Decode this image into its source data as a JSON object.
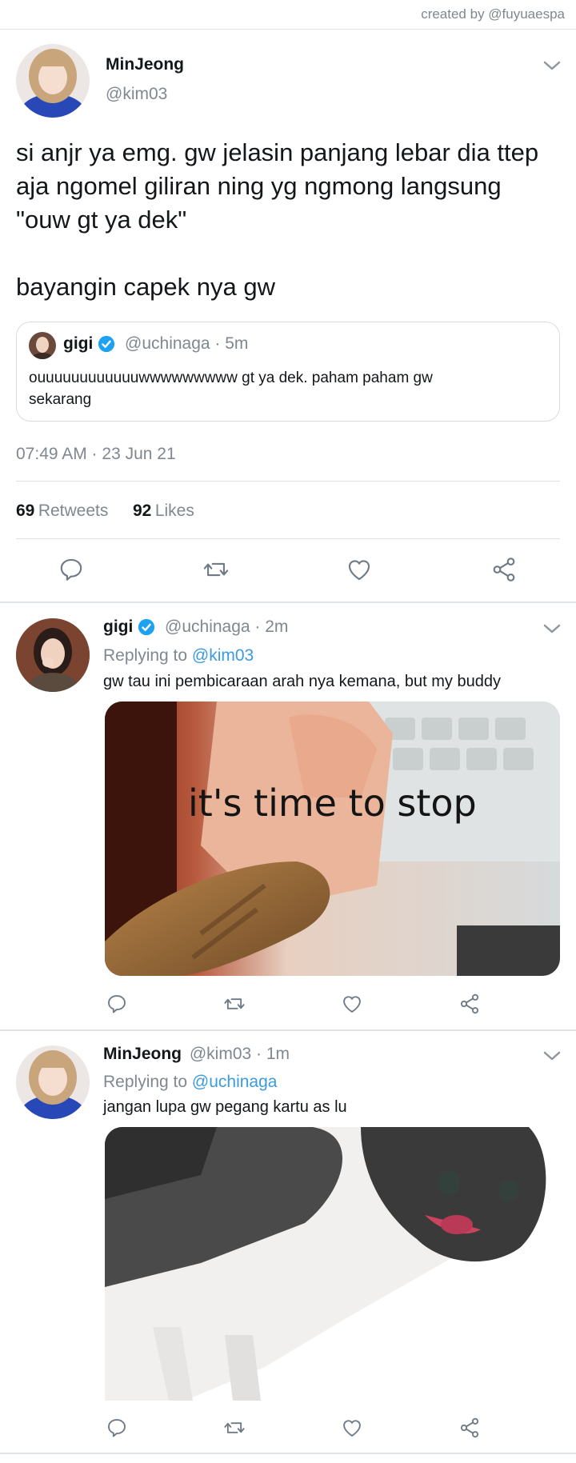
{
  "credit": "created by @fuyuaespa",
  "main_tweet": {
    "name": "MinJeong",
    "handle": "@kim03",
    "text_lines": [
      "si anjr ya emg. gw jelasin panjang lebar dia ttep",
      "aja ngomel giliran ning yg ngmong langsung",
      "\"ouw gt ya dek\"",
      "",
      "bayangin capek nya gw"
    ],
    "quote": {
      "name": "gigi",
      "handle": "@uchinaga",
      "time": "· 5m",
      "text_lines": [
        "ouuuuuuuuuuuuwwwwwwwww gt ya dek. paham paham gw",
        "sekarang"
      ]
    },
    "timestamp": "07:49 AM · 23 Jun 21",
    "retweets_count": "69",
    "retweets_label": "Retweets",
    "likes_count": "92",
    "likes_label": "Likes"
  },
  "reply1": {
    "name": "gigi",
    "handle": "@uchinaga",
    "time": "· 2m",
    "replying_prefix": "Replying to ",
    "replying_to": "@kim03",
    "text": "gw tau ini pembicaraan arah nya kemana, but my buddy",
    "image_caption": "it's time to stop"
  },
  "reply2": {
    "name": "MinJeong",
    "handle": "@kim03",
    "time": "· 1m",
    "replying_prefix": "Replying to ",
    "replying_to": "@uchinaga",
    "text": "jangan lupa gw pegang kartu as lu"
  },
  "icons": {
    "reply": "reply-icon",
    "retweet": "retweet-icon",
    "like": "heart-icon",
    "share": "share-icon",
    "chevron": "chevron-down-icon",
    "verified": "verified-badge-icon"
  },
  "colors": {
    "link": "#3a9be0",
    "muted": "#7f8890",
    "verified": "#1da1f2"
  }
}
